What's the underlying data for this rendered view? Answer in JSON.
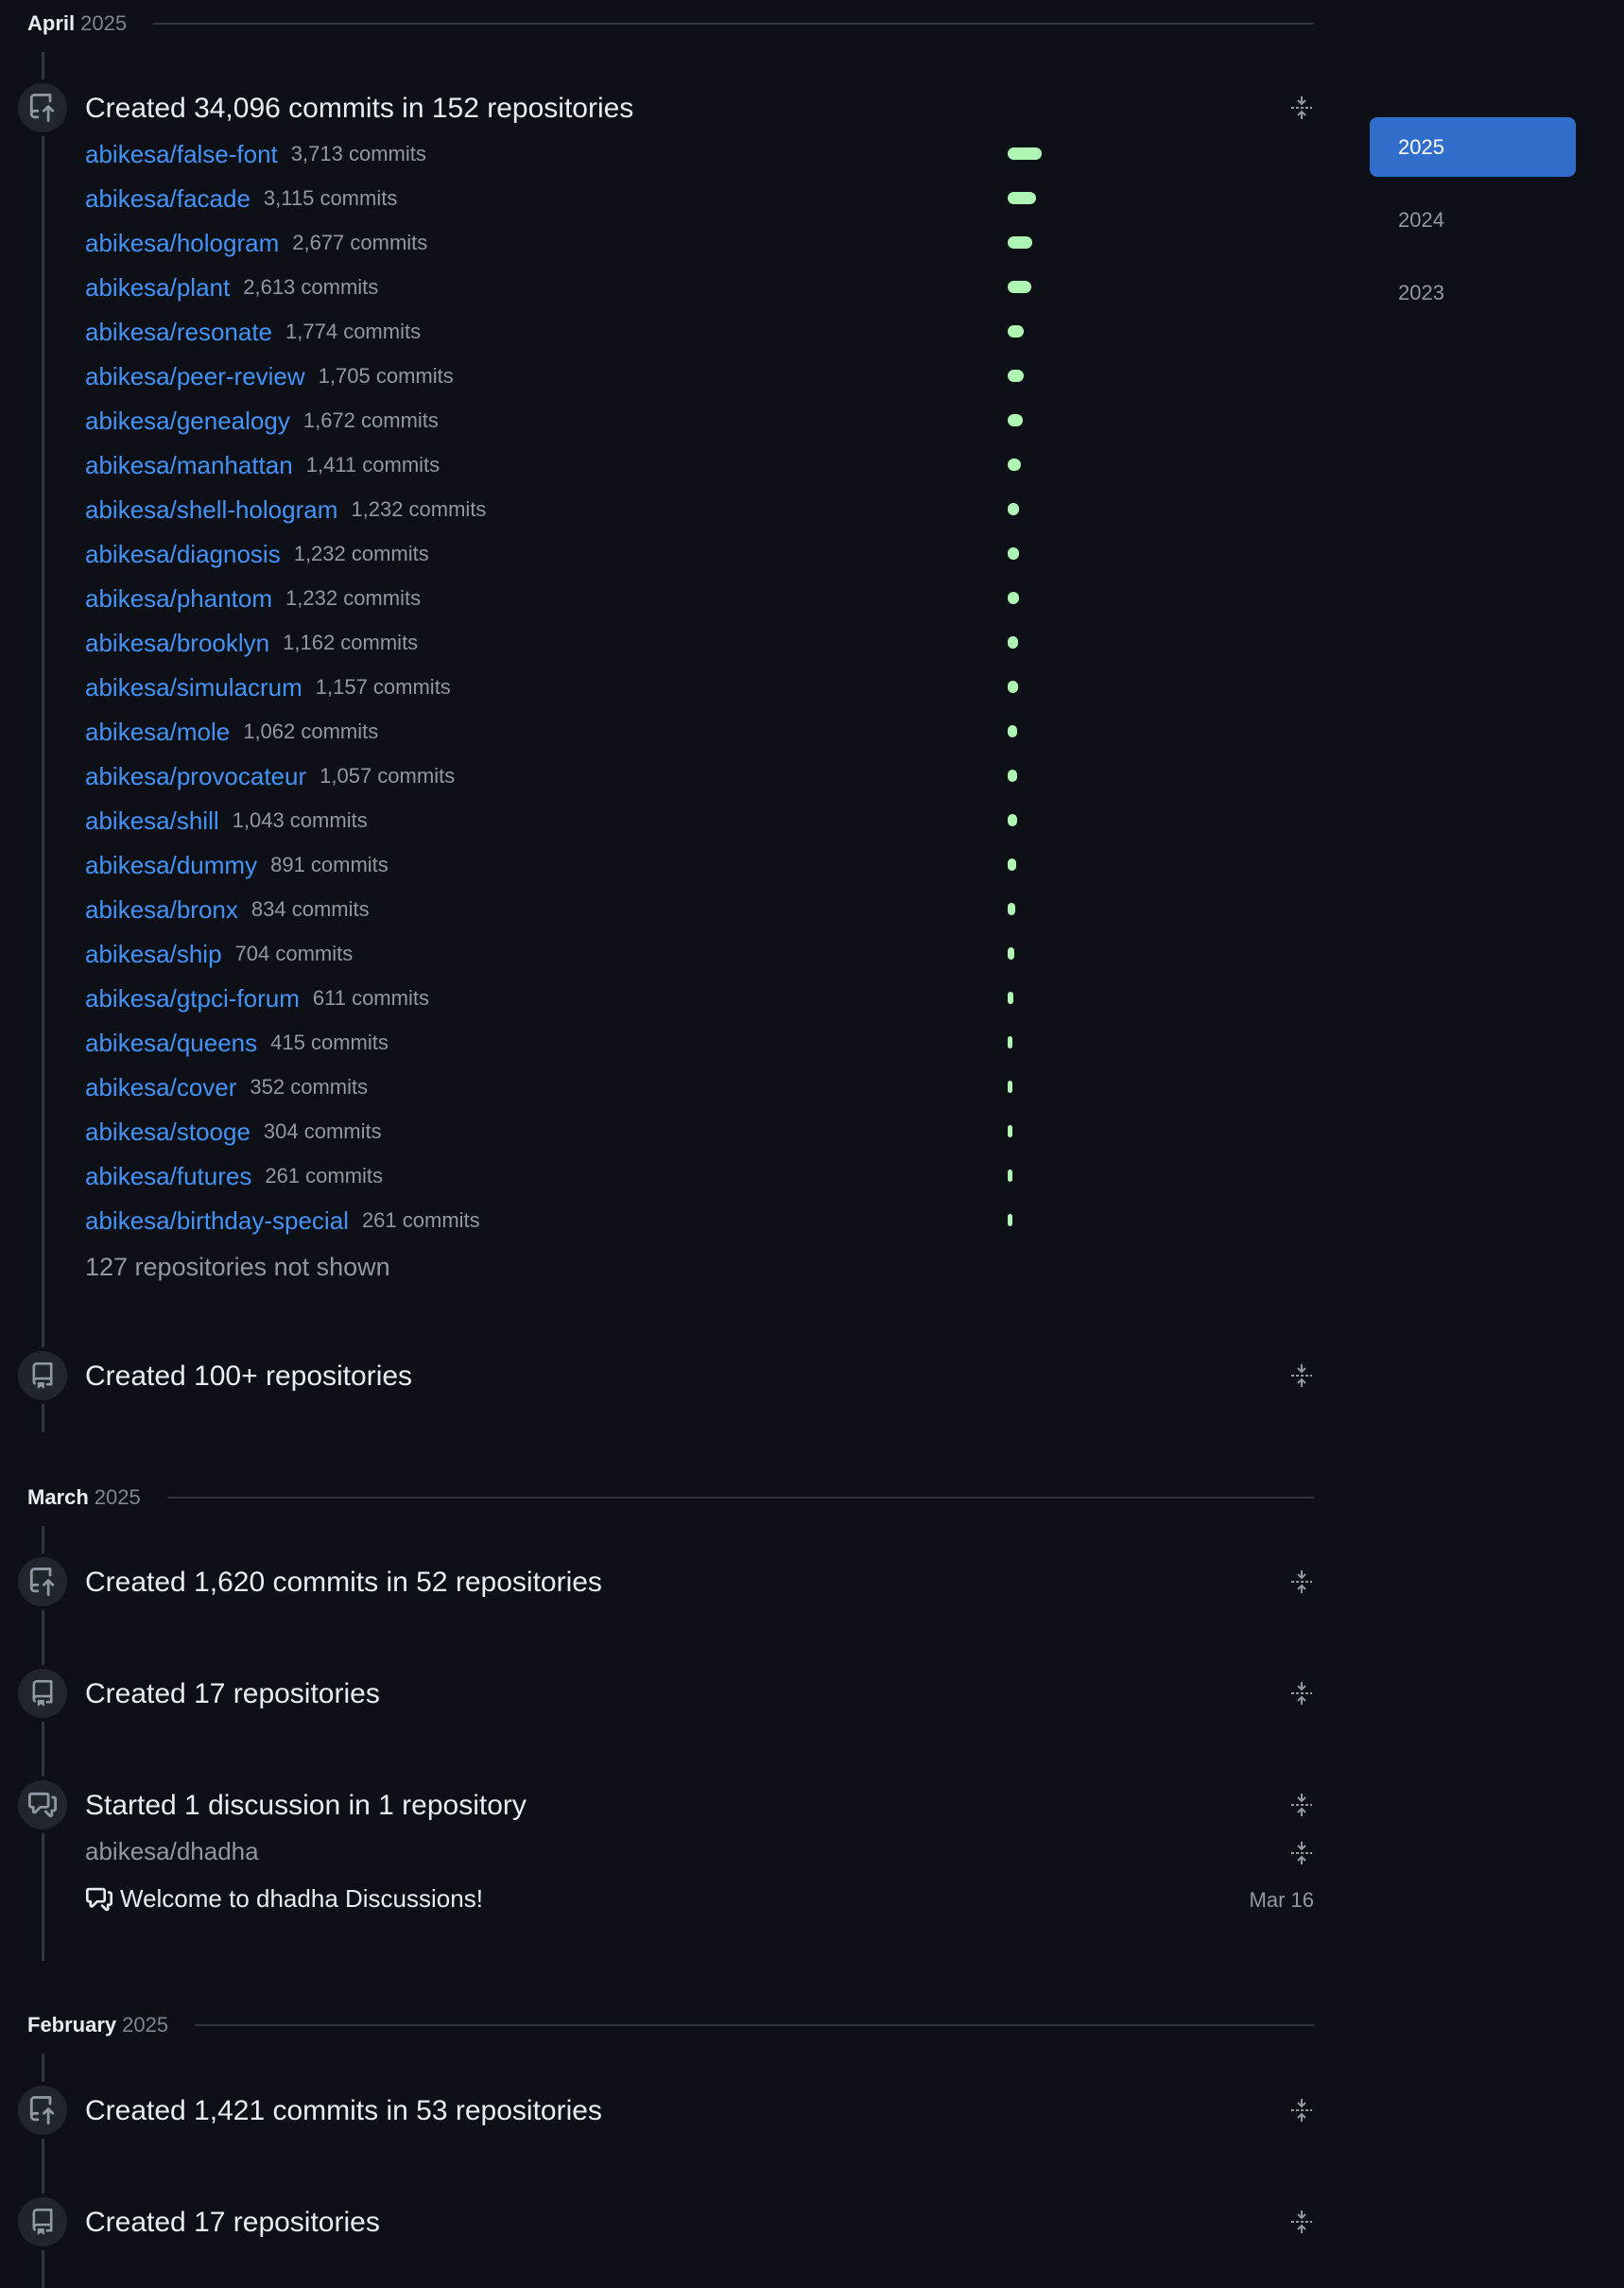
{
  "months": {
    "april": {
      "name": "April",
      "year": "2025"
    },
    "march": {
      "name": "March",
      "year": "2025"
    },
    "february": {
      "name": "February",
      "year": "2025"
    }
  },
  "april": {
    "commits_title": "Created 34,096 commits in 152 repositories",
    "repos": [
      {
        "name": "abikesa/false-font",
        "count": "3,713 commits",
        "commits": 3713
      },
      {
        "name": "abikesa/facade",
        "count": "3,115 commits",
        "commits": 3115
      },
      {
        "name": "abikesa/hologram",
        "count": "2,677 commits",
        "commits": 2677
      },
      {
        "name": "abikesa/plant",
        "count": "2,613 commits",
        "commits": 2613
      },
      {
        "name": "abikesa/resonate",
        "count": "1,774 commits",
        "commits": 1774
      },
      {
        "name": "abikesa/peer-review",
        "count": "1,705 commits",
        "commits": 1705
      },
      {
        "name": "abikesa/genealogy",
        "count": "1,672 commits",
        "commits": 1672
      },
      {
        "name": "abikesa/manhattan",
        "count": "1,411 commits",
        "commits": 1411
      },
      {
        "name": "abikesa/shell-hologram",
        "count": "1,232 commits",
        "commits": 1232
      },
      {
        "name": "abikesa/diagnosis",
        "count": "1,232 commits",
        "commits": 1232
      },
      {
        "name": "abikesa/phantom",
        "count": "1,232 commits",
        "commits": 1232
      },
      {
        "name": "abikesa/brooklyn",
        "count": "1,162 commits",
        "commits": 1162
      },
      {
        "name": "abikesa/simulacrum",
        "count": "1,157 commits",
        "commits": 1157
      },
      {
        "name": "abikesa/mole",
        "count": "1,062 commits",
        "commits": 1062
      },
      {
        "name": "abikesa/provocateur",
        "count": "1,057 commits",
        "commits": 1057
      },
      {
        "name": "abikesa/shill",
        "count": "1,043 commits",
        "commits": 1043
      },
      {
        "name": "abikesa/dummy",
        "count": "891 commits",
        "commits": 891
      },
      {
        "name": "abikesa/bronx",
        "count": "834 commits",
        "commits": 834
      },
      {
        "name": "abikesa/ship",
        "count": "704 commits",
        "commits": 704
      },
      {
        "name": "abikesa/gtpci-forum",
        "count": "611 commits",
        "commits": 611
      },
      {
        "name": "abikesa/queens",
        "count": "415 commits",
        "commits": 415
      },
      {
        "name": "abikesa/cover",
        "count": "352 commits",
        "commits": 352
      },
      {
        "name": "abikesa/stooge",
        "count": "304 commits",
        "commits": 304
      },
      {
        "name": "abikesa/futures",
        "count": "261 commits",
        "commits": 261
      },
      {
        "name": "abikesa/birthday-special",
        "count": "261 commits",
        "commits": 261
      }
    ],
    "not_shown": "127 repositories not shown",
    "repos_title": "Created 100+ repositories"
  },
  "march": {
    "commits_title": "Created 1,620 commits in 52 repositories",
    "repos_title": "Created 17 repositories",
    "discussion_title": "Started 1 discussion in 1 repository",
    "discussion_repo": "abikesa/dhadha",
    "discussion_item": "Welcome to dhadha Discussions!",
    "discussion_date": "Mar 16"
  },
  "february": {
    "commits_title": "Created 1,421 commits in 53 repositories",
    "repos_title": "Created 17 repositories"
  },
  "years": [
    {
      "label": "2025",
      "active": true
    },
    {
      "label": "2024",
      "active": false
    },
    {
      "label": "2023",
      "active": false
    }
  ],
  "colors": {
    "link": "#4493f8",
    "bar": "#aff5b4",
    "active_year": "#316dca",
    "background": "#0d1117"
  },
  "icons": {
    "commits": "repo-push-icon",
    "repos": "repo-icon",
    "discussion": "comment-discussion-icon",
    "fold": "fold-icon"
  }
}
